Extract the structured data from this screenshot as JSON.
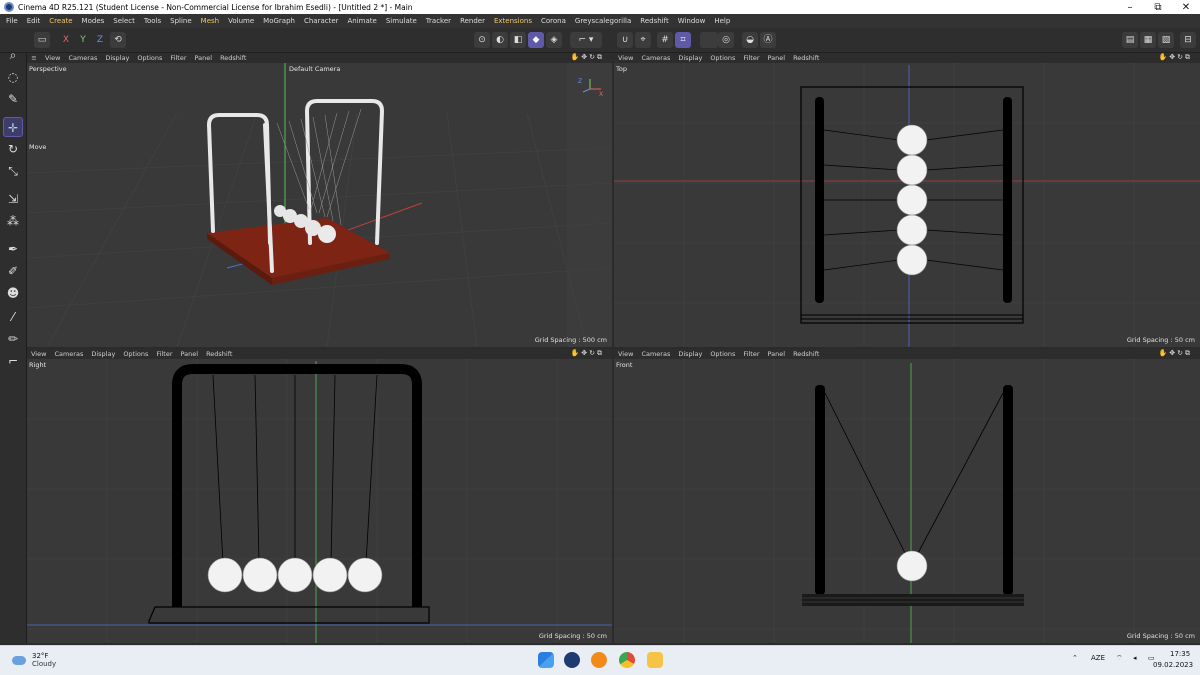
{
  "window": {
    "title": "Cinema 4D R25.121 (Student License - Non-Commercial License for Ibrahim Esedli) - [Untitled 2 *] - Main",
    "minimize": "–",
    "maximize": "⧉",
    "close": "✕"
  },
  "menu": [
    "File",
    "Edit",
    "Create",
    "Modes",
    "Select",
    "Tools",
    "Spline",
    "Mesh",
    "Volume",
    "MoGraph",
    "Character",
    "Animate",
    "Simulate",
    "Tracker",
    "Render",
    "Extensions",
    "Corona",
    "Greyscalegorilla",
    "Redshift",
    "Window",
    "Help"
  ],
  "menu_highlight": [
    "Create",
    "Mesh",
    "Extensions"
  ],
  "toolbar": {
    "x": "X",
    "y": "Y",
    "z": "Z"
  },
  "viewport_menu": [
    "View",
    "Cameras",
    "Display",
    "Options",
    "Filter",
    "Panel",
    "Redshift"
  ],
  "viewports": {
    "perspective": {
      "name": "Perspective",
      "camera": "Default Camera",
      "tool": "Move",
      "grid": "Grid Spacing : 500 cm"
    },
    "top": {
      "name": "Top",
      "grid": "Grid Spacing : 50 cm"
    },
    "right": {
      "name": "Right",
      "grid": "Grid Spacing : 50 cm"
    },
    "front": {
      "name": "Front",
      "grid": "Grid Spacing : 50 cm"
    }
  },
  "taskbar": {
    "temp": "32°F",
    "weather": "Cloudy",
    "lang": "AZE",
    "time": "17:35",
    "date": "09.02.2023"
  },
  "colors": {
    "accent": "#5f5aa8",
    "axis_x": "#e36464",
    "axis_y": "#7ad26a",
    "axis_z": "#6b8fe8",
    "wood": "#8a2a1a",
    "menu_highlight": "#f0c86a"
  }
}
